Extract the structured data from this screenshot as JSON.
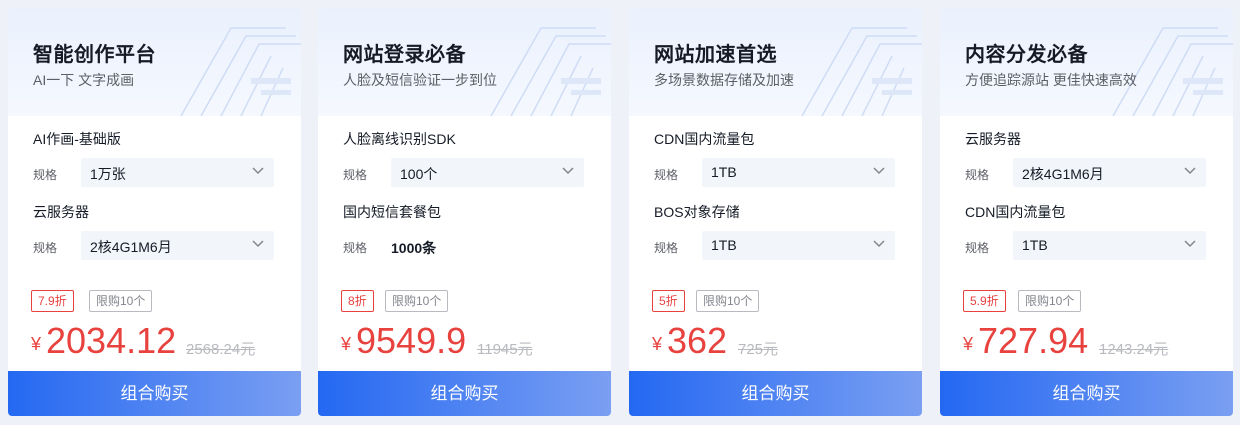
{
  "cards": [
    {
      "title": "智能创作平台",
      "subtitle": "AI一下 文字成画",
      "items": [
        {
          "name": "AI作画-基础版",
          "spec_label": "规格",
          "spec_value": "1万张"
        },
        {
          "name": "云服务器",
          "spec_label": "规格",
          "spec_value": "2核4G1M6月"
        }
      ],
      "discount": "7.9折",
      "limit": "限购10个",
      "currency": "¥",
      "price": "2034.12",
      "original_price": "2568.24元",
      "button": "组合购买"
    },
    {
      "title": "网站登录必备",
      "subtitle": "人脸及短信验证一步到位",
      "items": [
        {
          "name": "人脸离线识别SDK",
          "spec_label": "规格",
          "spec_value": "100个"
        },
        {
          "name": "国内短信套餐包",
          "spec_label": "规格",
          "spec_value": "1000条"
        }
      ],
      "discount": "8折",
      "limit": "限购10个",
      "currency": "¥",
      "price": "9549.9",
      "original_price": "11945元",
      "button": "组合购买"
    },
    {
      "title": "网站加速首选",
      "subtitle": "多场景数据存储及加速",
      "items": [
        {
          "name": "CDN国内流量包",
          "spec_label": "规格",
          "spec_value": "1TB"
        },
        {
          "name": "BOS对象存储",
          "spec_label": "规格",
          "spec_value": "1TB"
        }
      ],
      "discount": "5折",
      "limit": "限购10个",
      "currency": "¥",
      "price": "362",
      "original_price": "725元",
      "button": "组合购买"
    },
    {
      "title": "内容分发必备",
      "subtitle": "方便追踪源站 更佳快速高效",
      "items": [
        {
          "name": "云服务器",
          "spec_label": "规格",
          "spec_value": "2核4G1M6月"
        },
        {
          "name": "CDN国内流量包",
          "spec_label": "规格",
          "spec_value": "1TB"
        }
      ],
      "discount": "5.9折",
      "limit": "限购10个",
      "currency": "¥",
      "price": "727.94",
      "original_price": "1243.24元",
      "button": "组合购买"
    }
  ],
  "colors": {
    "accent": "#2468f2",
    "price": "#e8423f",
    "spec_bg": "#f2f5fa"
  }
}
